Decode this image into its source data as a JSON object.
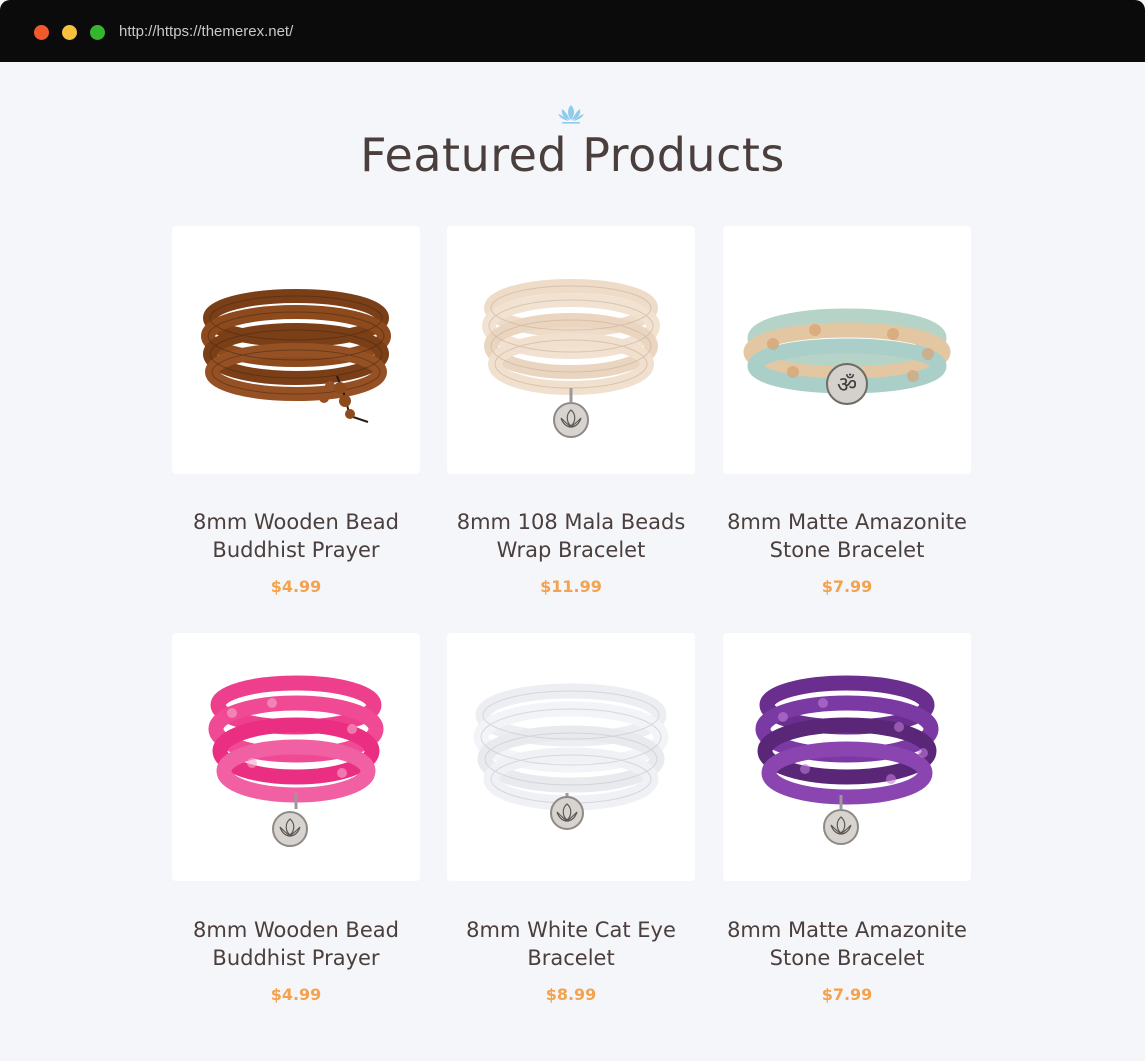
{
  "browser": {
    "url": "http://https://themerex.net/"
  },
  "section": {
    "icon": "lotus-icon",
    "title": "Featured Products"
  },
  "products": [
    {
      "name_line1": "8mm Wooden Bead",
      "name_line2": "Buddhist Prayer",
      "price": "$4.99",
      "image": "wooden-bead-bracelet"
    },
    {
      "name_line1": "8mm 108 Mala Beads",
      "name_line2": "Wrap Bracelet",
      "price": "$11.99",
      "image": "cream-mala-bracelet"
    },
    {
      "name_line1": "8mm Matte Amazonite",
      "name_line2": "Stone Bracelet",
      "price": "$7.99",
      "image": "amazonite-om-bracelet"
    },
    {
      "name_line1": "8mm Wooden Bead",
      "name_line2": "Buddhist Prayer",
      "price": "$4.99",
      "image": "pink-agate-bracelet"
    },
    {
      "name_line1": "8mm White Cat Eye",
      "name_line2": "Bracelet",
      "price": "$8.99",
      "image": "white-cat-eye-bracelet"
    },
    {
      "name_line1": "8mm Matte Amazonite",
      "name_line2": "Stone Bracelet",
      "price": "$7.99",
      "image": "purple-agate-bracelet"
    }
  ],
  "colors": {
    "titlebar": "#0b0b0b",
    "background": "#f5f6fa",
    "heading": "#4a3f3c",
    "price": "#f4a24d",
    "lotus": "#8fcbea"
  }
}
